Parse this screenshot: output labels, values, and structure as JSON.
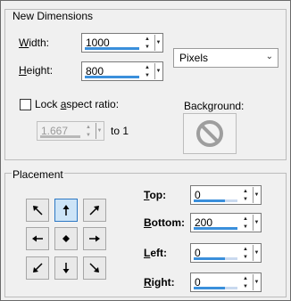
{
  "new_dimensions": {
    "title": "New Dimensions",
    "width": {
      "label_pre": "",
      "label_u": "W",
      "label_post": "idth:",
      "value": "1000",
      "fill": 1.0
    },
    "height": {
      "label_pre": "",
      "label_u": "H",
      "label_post": "eight:",
      "value": "800",
      "fill": 1.0
    },
    "units": {
      "selected": "Pixels"
    },
    "lock_aspect": {
      "label_pre": "Lock ",
      "label_u": "a",
      "label_post": "spect ratio:",
      "checked": false
    },
    "ratio": {
      "value": "1.667",
      "suffix": "to 1",
      "fill": 1.0
    },
    "background": {
      "label": "Background:",
      "icon": "no-symbol-icon"
    }
  },
  "placement": {
    "title": "Placement",
    "selected": "top-center",
    "top": {
      "label_pre": "",
      "label_u": "T",
      "label_post": "op:",
      "value": "0",
      "fill": 0.72
    },
    "bottom": {
      "label_pre": "",
      "label_u": "B",
      "label_post": "ottom:",
      "value": "200",
      "fill": 1.0
    },
    "left": {
      "label_pre": "",
      "label_u": "L",
      "label_post": "eft:",
      "value": "0",
      "fill": 0.72
    },
    "right": {
      "label_pre": "",
      "label_u": "R",
      "label_post": "ight:",
      "value": "0",
      "fill": 0.72
    }
  },
  "colors": {
    "accent": "#3a8fdb",
    "selected_bg": "#cde4f7",
    "selected_border": "#2d78c4"
  }
}
